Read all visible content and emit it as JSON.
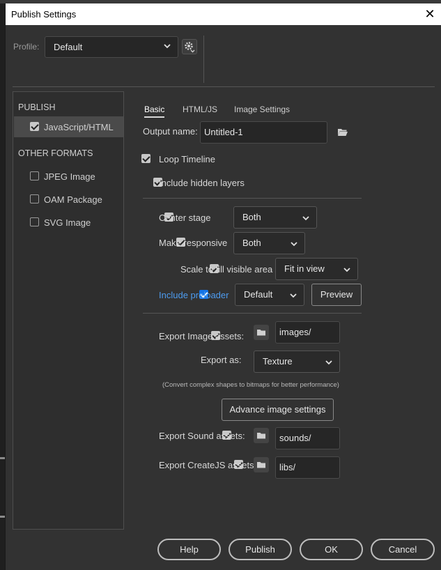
{
  "window": {
    "title": "Publish Settings"
  },
  "profile": {
    "label": "Profile:",
    "value": "Default"
  },
  "categories": {
    "publish_heading": "PUBLISH",
    "publish_items": [
      {
        "label": "JavaScript/HTML",
        "checked": true
      }
    ],
    "other_heading": "OTHER FORMATS",
    "other_items": [
      {
        "label": "JPEG Image",
        "checked": false
      },
      {
        "label": "OAM Package",
        "checked": false
      },
      {
        "label": "SVG Image",
        "checked": false
      }
    ]
  },
  "tabs": [
    {
      "label": "Basic"
    },
    {
      "label": "HTML/JS"
    },
    {
      "label": "Image Settings"
    }
  ],
  "basic": {
    "output_name": {
      "label": "Output name:",
      "value": "Untitled-1"
    },
    "loop_timeline": {
      "label": "Loop Timeline",
      "checked": true
    },
    "include_hidden_layers": {
      "label": "Include hidden layers",
      "checked": true
    },
    "center_stage": {
      "label": "Center stage",
      "checked": true,
      "value": "Both"
    },
    "make_responsive": {
      "label": "Make responsive",
      "checked": true,
      "value": "Both"
    },
    "scale_to_fill": {
      "label": "Scale to fill visible area",
      "checked": true,
      "value": "Fit in view"
    },
    "include_preloader": {
      "label": "Include preloader",
      "checked": true,
      "value": "Default",
      "preview_label": "Preview"
    },
    "export_image_assets": {
      "label": "Export Image assets:",
      "checked": true,
      "value": "images/"
    },
    "export_as": {
      "label": "Export as:",
      "value": "Texture"
    },
    "convert_note": "(Convert complex shapes to bitmaps for better performance)",
    "advance_image_settings_label": "Advance image settings",
    "export_sound_assets": {
      "label": "Export Sound assets:",
      "checked": true,
      "value": "sounds/"
    },
    "export_createjs_assets": {
      "label": "Export CreateJS assets:",
      "checked": true,
      "value": "libs/"
    }
  },
  "footer": {
    "help": "Help",
    "publish": "Publish",
    "ok": "OK",
    "cancel": "Cancel"
  },
  "colors": {
    "accent": "#1473e6",
    "preloader_label": "#4d9cf0",
    "dialog_bg": "#323232"
  }
}
